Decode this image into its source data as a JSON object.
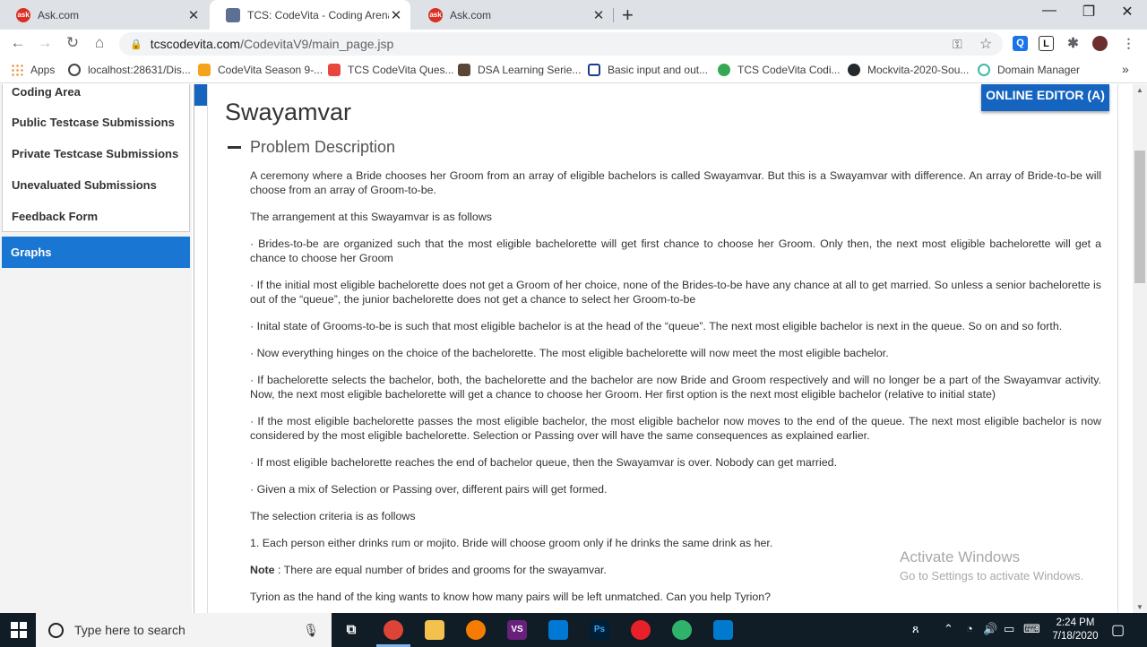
{
  "browser": {
    "tabs": [
      {
        "title": "Ask.com",
        "favicon": "ask-favicon",
        "active": false
      },
      {
        "title": "TCS: CodeVita - Coding Arena",
        "favicon": "tcs-favicon",
        "active": true
      },
      {
        "title": "Ask.com",
        "favicon": "ask-favicon",
        "active": false
      }
    ],
    "url_domain": "tcscodevita.com",
    "url_path": "/CodevitaV9/main_page.jsp",
    "bookmarks": [
      {
        "label": "Apps",
        "icon": "apps-grid-icon"
      },
      {
        "label": "localhost:28631/Dis...",
        "icon": "globe-icon"
      },
      {
        "label": "CodeVita Season 9-...",
        "icon": "codevita-icon"
      },
      {
        "label": "TCS CodeVita Ques...",
        "icon": "tcs-icon"
      },
      {
        "label": "DSA Learning Serie...",
        "icon": "codechef-icon"
      },
      {
        "label": "Basic input and out...",
        "icon": "geeks-icon"
      },
      {
        "label": "TCS CodeVita Codi...",
        "icon": "play-icon"
      },
      {
        "label": "Mockvita-2020-Sou...",
        "icon": "github-icon"
      },
      {
        "label": "Domain Manager",
        "icon": "domain-icon"
      }
    ],
    "more_bookmarks": "»"
  },
  "sidebar": {
    "items": [
      {
        "label": "Coding Area"
      },
      {
        "label": "Public Testcase Submissions"
      },
      {
        "label": "Private Testcase Submissions"
      },
      {
        "label": "Unevaluated Submissions"
      },
      {
        "label": "Feedback Form"
      }
    ],
    "active_item": "Graphs"
  },
  "main": {
    "editor_button": "ONLINE EDITOR (A)",
    "problem_title": "Swayamvar",
    "section_title": "Problem Description",
    "paragraphs": [
      "A ceremony where a Bride chooses her Groom from an array of eligible bachelors is called Swayamvar. But this is a Swayamvar with difference. An array of Bride-to-be will choose from an array of Groom-to-be.",
      "The arrangement at this Swayamvar is as follows",
      "· Brides-to-be are organized such that the most eligible bachelorette will get first chance to choose her Groom. Only then, the next most eligible bachelorette will get a chance to choose her Groom",
      "· If the initial most eligible bachelorette does not get a Groom of her choice, none of the Brides-to-be have any chance at all to get married. So unless a senior bachelorette is out of the “queue”, the junior bachelorette does not get a chance to select her Groom-to-be",
      "· Inital state of Grooms-to-be is such that most eligible bachelor is at the head of the “queue”. The next most eligible bachelor is next in the queue. So on and so forth.",
      "· Now everything hinges on the choice of the bachelorette. The most eligible bachelorette will now meet the most eligible bachelor.",
      "· If bachelorette selects the bachelor, both, the bachelorette and the bachelor are now Bride and Groom respectively and will no longer be a part of the Swayamvar activity. Now, the next most eligible bachelorette will get a chance to choose her Groom. Her first option is the next most eligible bachelor (relative to initial state)",
      "· If the most eligible bachelorette passes the most eligible bachelor, the most eligible bachelor now moves to the end of the queue. The next most eligible bachelor is now considered by the most eligible bachelorette. Selection or Passing over will have the same consequences as explained earlier.",
      "· If most eligible bachelorette reaches the end of bachelor queue, then the Swayamvar is over. Nobody can get married.",
      "· Given a mix of Selection or Passing over, different pairs will get formed.",
      "The selection criteria is as follows",
      "1. Each person either drinks rum or mojito. Bride will choose groom only if he drinks the same drink as her."
    ],
    "note_label": "Note",
    "note_text": " : There are equal number of brides and grooms for the swayamvar.",
    "last_line": "Tyrion as the hand of the king wants to know how many pairs will be left unmatched. Can you help Tyrion?"
  },
  "watermark": {
    "line1": "Activate Windows",
    "line2": "Go to Settings to activate Windows."
  },
  "taskbar": {
    "search_placeholder": "Type here to search",
    "time": "2:24 PM",
    "date": "7/18/2020"
  }
}
